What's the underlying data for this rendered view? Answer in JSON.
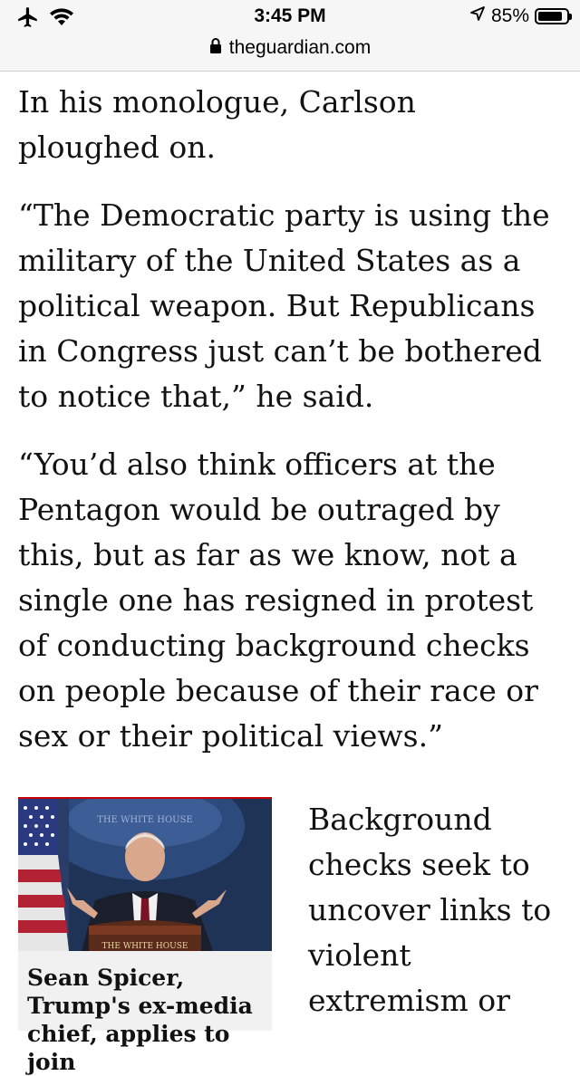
{
  "status_bar": {
    "time": "3:45 PM",
    "url": "theguardian.com",
    "battery_text": "85%",
    "battery_level": 0.85,
    "icons": [
      "airplane-icon",
      "wifi-icon",
      "lock-icon",
      "location-arrow-icon",
      "battery-icon"
    ]
  },
  "article": {
    "paragraphs": [
      "In his monologue, Carlson ploughed on.",
      "“The Democratic party is using the military of the United States as a political weapon. But Republicans in Congress just can’t be bothered to notice that,” he said.",
      "“You’d also think officers at the Pentagon would be outraged by this, but as far as we know, not a single one has resigned in protest of conducting background checks on people because of their race or sex or their political views.”"
    ],
    "related_card": {
      "image_sign_top": "THE WHITE HOUSE",
      "image_podium_text": "THE WHITE HOUSE",
      "headline": "Sean Spicer, Trump's ex-media chief, applies to join"
    },
    "side_paragraph": "Background checks seek to uncover links to violent extremism or"
  },
  "colors": {
    "accent_red": "#c70000",
    "text": "#121212",
    "card_bg": "#f1f1f1"
  }
}
